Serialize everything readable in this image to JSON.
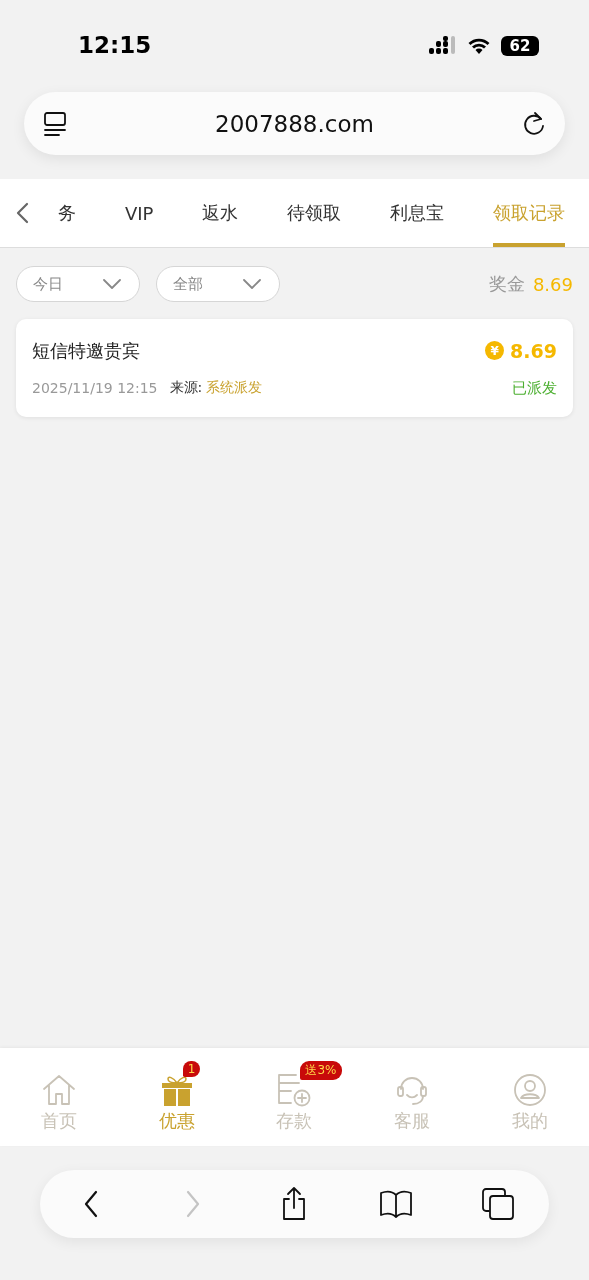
{
  "status_bar": {
    "time": "12:15",
    "battery": "62"
  },
  "address_bar": {
    "url": "2007888.com"
  },
  "tabs": [
    {
      "label": "务",
      "selected": false
    },
    {
      "label": "VIP",
      "selected": false
    },
    {
      "label": "返水",
      "selected": false
    },
    {
      "label": "待领取",
      "selected": false
    },
    {
      "label": "利息宝",
      "selected": false
    },
    {
      "label": "领取记录",
      "selected": true
    }
  ],
  "filters": [
    {
      "value": "今日"
    },
    {
      "value": "全部"
    }
  ],
  "bonus": {
    "label": "奖金",
    "amount": "8.69"
  },
  "records": [
    {
      "title": "短信特邀贵宾",
      "currency": "¥",
      "amount": "8.69",
      "time": "2025/11/19 12:15",
      "source_label": "来源:",
      "source": "系统派发",
      "status": "已派发"
    }
  ],
  "bottom_nav": [
    {
      "kind": "home",
      "label": "首页",
      "selected": false
    },
    {
      "kind": "gift",
      "label": "优惠",
      "selected": true,
      "badge": "1"
    },
    {
      "kind": "deposit",
      "label": "存款",
      "selected": false,
      "badge": "送3%"
    },
    {
      "kind": "support",
      "label": "客服",
      "selected": false
    },
    {
      "kind": "profile",
      "label": "我的",
      "selected": false
    }
  ],
  "browser_toolbar": {
    "forward_disabled": true
  }
}
